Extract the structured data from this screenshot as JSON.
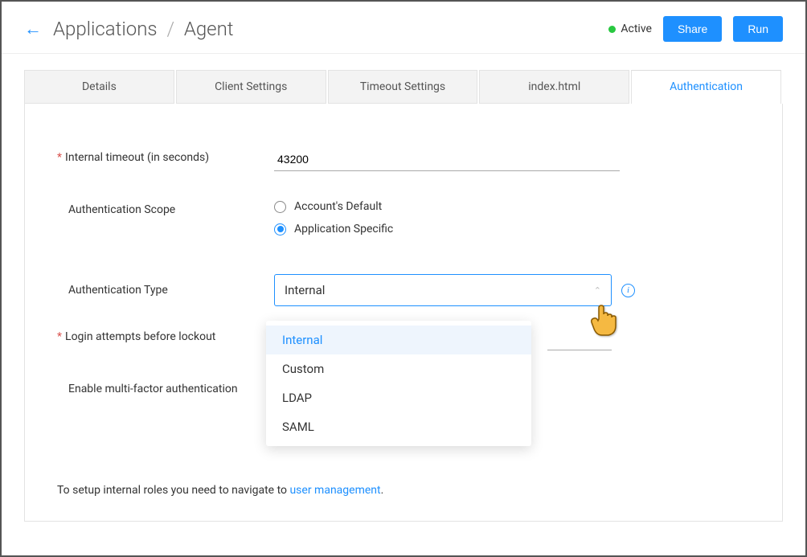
{
  "header": {
    "breadcrumb_root": "Applications",
    "breadcrumb_sep": "/",
    "breadcrumb_page": "Agent",
    "status_label": "Active",
    "share_label": "Share",
    "run_label": "Run"
  },
  "tabs": {
    "details": "Details",
    "client": "Client Settings",
    "timeout": "Timeout Settings",
    "index": "index.html",
    "auth": "Authentication"
  },
  "fields": {
    "internal_timeout_label": "Internal timeout (in seconds)",
    "internal_timeout_value": "43200",
    "auth_scope_label": "Authentication Scope",
    "scope_default": "Account's Default",
    "scope_app": "Application Specific",
    "auth_type_label": "Authentication Type",
    "auth_type_value": "Internal",
    "login_attempts_label": "Login attempts before lockout",
    "mfa_label": "Enable multi-factor authentication"
  },
  "dropdown": {
    "o1": "Internal",
    "o2": "Custom",
    "o3": "LDAP",
    "o4": "SAML"
  },
  "footer": {
    "text": "To setup internal roles you need to navigate to ",
    "link": "user management",
    "dot": "."
  },
  "asterisk": "*"
}
